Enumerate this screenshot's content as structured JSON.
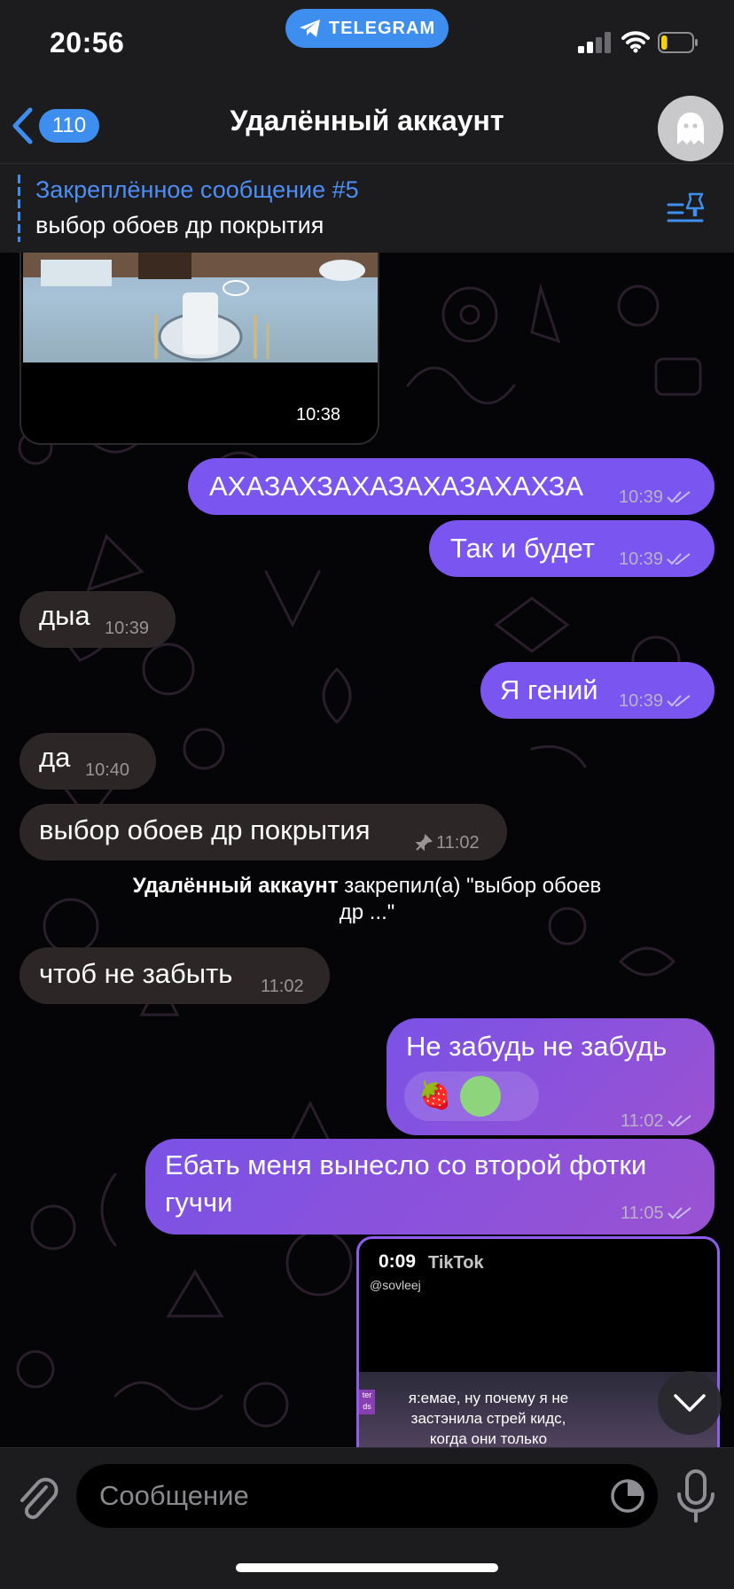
{
  "status_bar": {
    "time": "20:56",
    "app_pill": "TELEGRAM",
    "battery_level": 0.2
  },
  "header": {
    "back_count": "110",
    "title": "Удалённый аккаунт"
  },
  "pinned": {
    "title": "Закреплённое сообщение #5",
    "text": "выбор обоев др покрытия"
  },
  "messages": {
    "photo_time": "10:38",
    "m1": {
      "text": "АХАЗАХЗАХАЗАХАЗАХАХЗА",
      "time": "10:39"
    },
    "m2": {
      "text": "Так и будет",
      "time": "10:39"
    },
    "m3": {
      "text": "дыа",
      "time": "10:39"
    },
    "m4": {
      "text": "Я гений",
      "time": "10:39"
    },
    "m5": {
      "text": "да",
      "time": "10:40"
    },
    "m6": {
      "text": "выбор обоев др покрытия",
      "time": "11:02"
    },
    "service": {
      "actor": "Удалённый аккаунт",
      "line1": "закрепил(а) \"выбор обоев",
      "line2": "др ...\""
    },
    "m7": {
      "text": "чтоб не забыть",
      "time": "11:02"
    },
    "m8": {
      "text": "Не забудь не забудь",
      "time": "11:02",
      "reaction_emoji": "🍓"
    },
    "m9": {
      "line1": "Ебать меня вынесло со второй фотки",
      "line2": "гуччи",
      "time": "11:05"
    },
    "video": {
      "duration": "0:09",
      "brand": "TikTok",
      "handle": "@sovleej",
      "badge_top": "ter",
      "badge_bottom": "ds",
      "caption1": "я:емае, ну почему я не",
      "caption2": "застэнила стрей кидс,",
      "caption3": "когда они только"
    }
  },
  "input": {
    "placeholder": "Сообщение"
  },
  "colors": {
    "accent": "#3e8ef0",
    "outgoing": "#7a55ef",
    "incoming": "#2c2626"
  }
}
